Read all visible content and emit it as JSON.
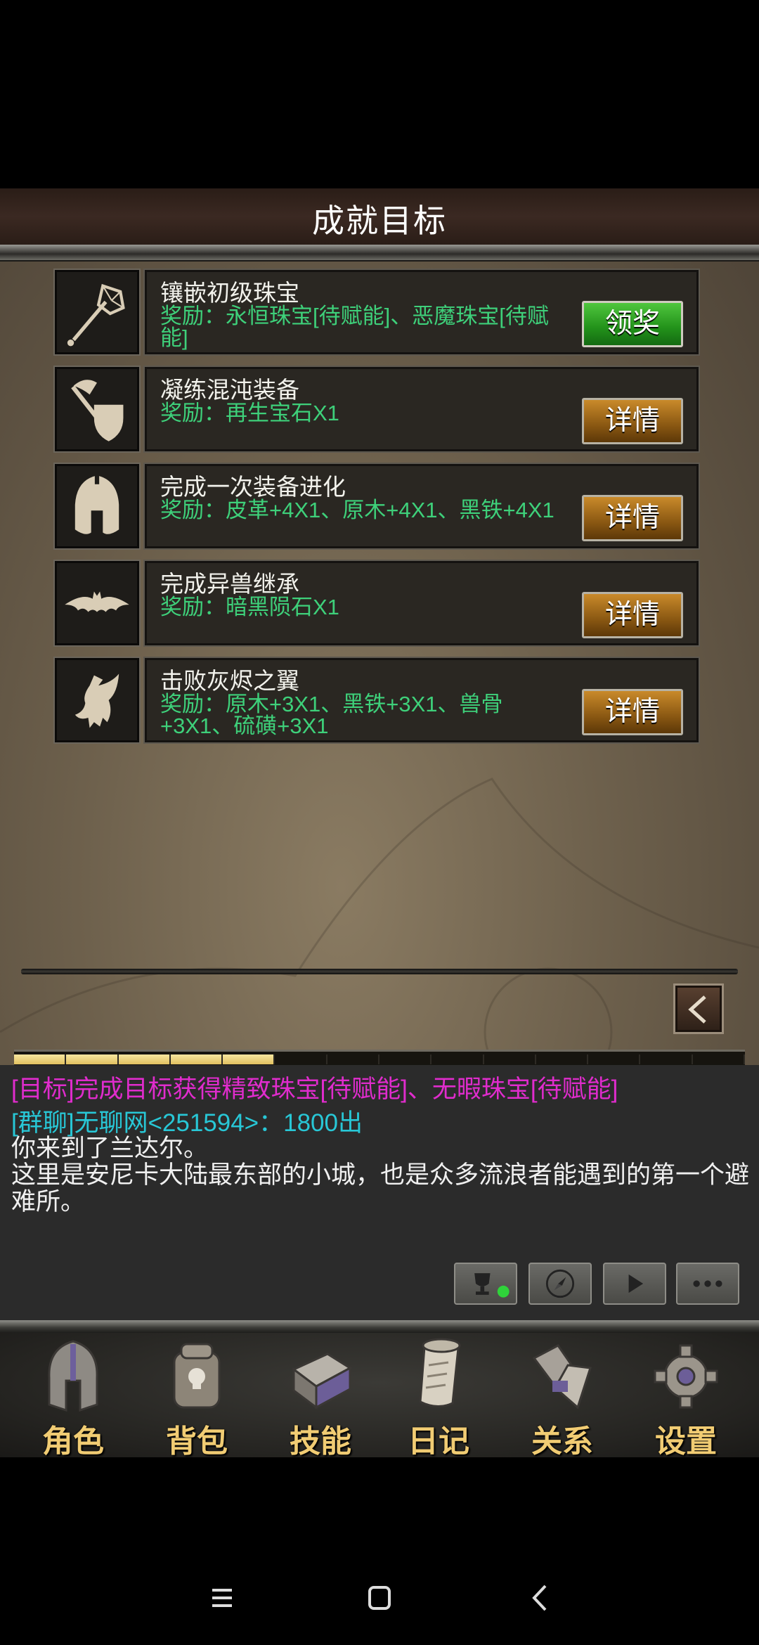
{
  "header": {
    "title": "成就目标"
  },
  "achievements": [
    {
      "icon": "spiked-mace-icon",
      "name": "镶嵌初级珠宝",
      "reward": "奖励：永恒珠宝[待赋能]、恶魔珠宝[待赋能]",
      "button": "领奖",
      "button_state": "claimable"
    },
    {
      "icon": "axe-shield-icon",
      "name": "凝练混沌装备",
      "reward": "奖励：再生宝石X1",
      "button": "详情",
      "button_state": "details"
    },
    {
      "icon": "helmet-icon",
      "name": "完成一次装备进化",
      "reward": "奖励：皮革+4X1、原木+4X1、黑铁+4X1",
      "button": "详情",
      "button_state": "details"
    },
    {
      "icon": "bat-icon",
      "name": "完成异兽继承",
      "reward": "奖励：暗黑陨石X1",
      "button": "详情",
      "button_state": "details"
    },
    {
      "icon": "griffin-icon",
      "name": "击败灰烬之翼",
      "reward": "奖励：原木+3X1、黑铁+3X1、兽骨+3X1、硫磺+3X1",
      "button": "详情",
      "button_state": "details"
    }
  ],
  "experience": {
    "filled_segments": 5,
    "total_segments": 14
  },
  "chat": {
    "target_message": "[目标]完成目标获得精致珠宝[待赋能]、无暇珠宝[待赋能]",
    "group_message": "[群聊]无聊网<251594>：1800出",
    "system_message": "你来到了兰达尔。\n这里是安尼卡大陆最东部的小城，也是众多流浪者能遇到的第一个避难所。"
  },
  "chat_tools": [
    "trophy-icon",
    "compass-icon",
    "play-icon",
    "more-icon"
  ],
  "nav": [
    {
      "label": "角色",
      "icon": "knight-helmet-icon"
    },
    {
      "label": "背包",
      "icon": "backpack-icon"
    },
    {
      "label": "技能",
      "icon": "spellbook-icon"
    },
    {
      "label": "日记",
      "icon": "scroll-icon"
    },
    {
      "label": "关系",
      "icon": "handshake-icon"
    },
    {
      "label": "设置",
      "icon": "gear-icon"
    }
  ],
  "colors": {
    "reward": "#3ed07a",
    "target_chat": "#e02ccd",
    "group_chat": "#28c7d6",
    "nav_label": "#f1cc73"
  }
}
